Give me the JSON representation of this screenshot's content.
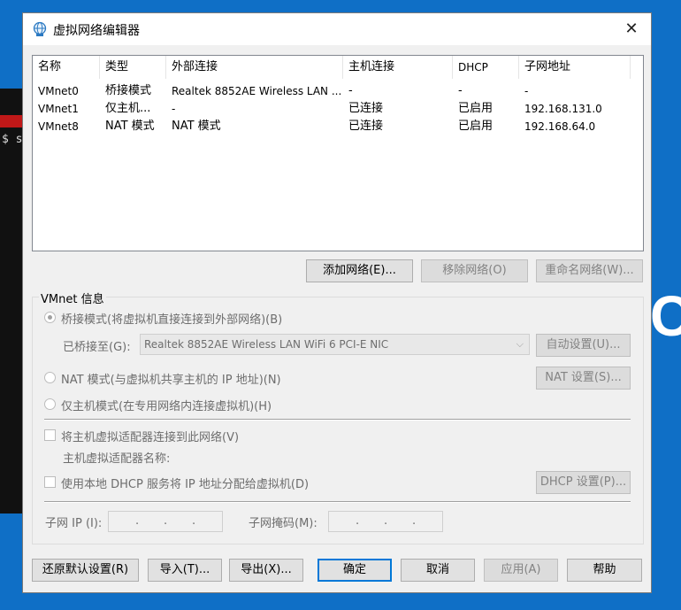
{
  "background": {
    "terminal_text": "$ s",
    "letter": "C"
  },
  "window": {
    "title": "虚拟网络编辑器",
    "close_symbol": "✕"
  },
  "network_list": {
    "columns": [
      "名称",
      "类型",
      "外部连接",
      "主机连接",
      "DHCP",
      "子网地址"
    ],
    "rows": [
      {
        "name": "VMnet0",
        "type": "桥接模式",
        "external": "Realtek 8852AE Wireless LAN ...",
        "host": "-",
        "dhcp": "-",
        "subnet": "-"
      },
      {
        "name": "VMnet1",
        "type": "仅主机...",
        "external": "-",
        "host": "已连接",
        "dhcp": "已启用",
        "subnet": "192.168.131.0"
      },
      {
        "name": "VMnet8",
        "type": "NAT 模式",
        "external": "NAT 模式",
        "host": "已连接",
        "dhcp": "已启用",
        "subnet": "192.168.64.0"
      }
    ]
  },
  "list_buttons": {
    "add": "添加网络(E)...",
    "remove": "移除网络(O)",
    "rename": "重命名网络(W)..."
  },
  "vmnet_info": {
    "group_label": "VMnet 信息",
    "bridged_radio": "桥接模式(将虚拟机直接连接到外部网络)(B)",
    "bridged_to_label": "已桥接至(G):",
    "bridged_to_value": "Realtek 8852AE Wireless LAN WiFi 6 PCI-E NIC",
    "auto_settings": "自动设置(U)...",
    "nat_radio": "NAT 模式(与虚拟机共享主机的 IP 地址)(N)",
    "nat_settings": "NAT 设置(S)...",
    "host_only_radio": "仅主机模式(在专用网络内连接虚拟机)(H)",
    "connect_adapter_check": "将主机虚拟适配器连接到此网络(V)",
    "adapter_name_label": "主机虚拟适配器名称:",
    "dhcp_check": "使用本地 DHCP 服务将 IP 地址分配给虚拟机(D)",
    "dhcp_settings": "DHCP 设置(P)...",
    "subnet_ip_label": "子网 IP (I):",
    "subnet_mask_label": "子网掩码(M):",
    "ip_dot": "."
  },
  "footer_buttons": {
    "restore": "还原默认设置(R)",
    "import": "导入(T)...",
    "export": "导出(X)...",
    "ok": "确定",
    "cancel": "取消",
    "apply": "应用(A)",
    "help": "帮助"
  }
}
